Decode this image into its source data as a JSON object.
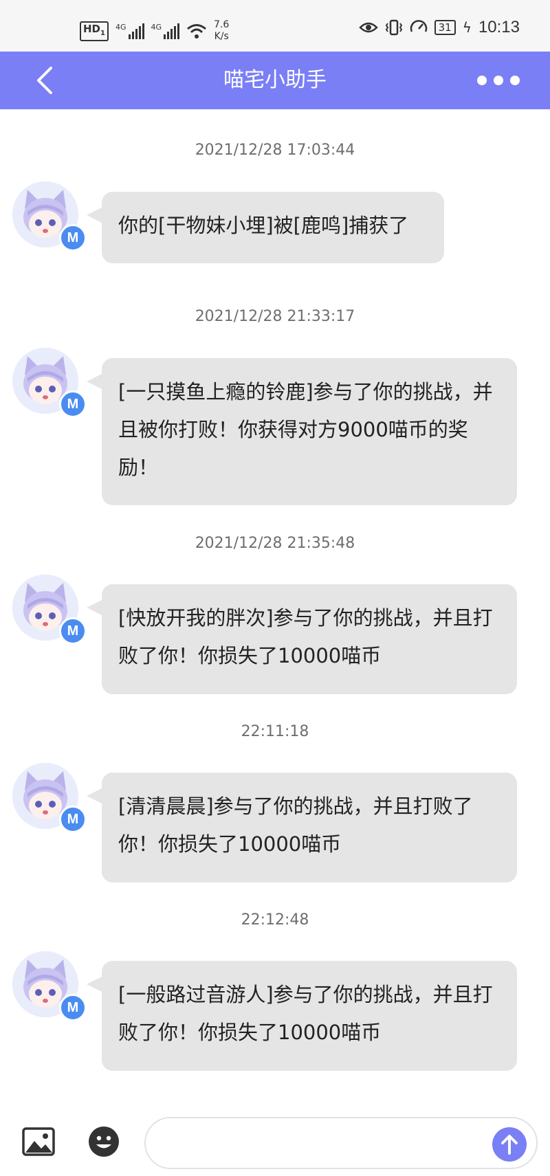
{
  "status_bar": {
    "hd": "HD",
    "sim": "1",
    "sig1_label": "4G",
    "sig2_label": "4G",
    "speed_value": "7.6",
    "speed_unit": "K/s",
    "battery": "31",
    "time": "10:13"
  },
  "header": {
    "title": "喵宅小助手"
  },
  "messages": [
    {
      "timestamp": "2021/12/28 17:03:44",
      "avatar_badge": "M",
      "text": "你的[干物妹小埋]被[鹿鸣]捕获了"
    },
    {
      "timestamp": "2021/12/28 21:33:17",
      "avatar_badge": "M",
      "text": "[一只摸鱼上瘾的铃鹿]参与了你的挑战，并且被你打败！你获得对方9000喵币的奖励！"
    },
    {
      "timestamp": "2021/12/28 21:35:48",
      "avatar_badge": "M",
      "text": "[快放开我的胖次]参与了你的挑战，并且打败了你！你损失了10000喵币"
    },
    {
      "timestamp": "22:11:18",
      "avatar_badge": "M",
      "text": "[清清晨晨]参与了你的挑战，并且打败了你！你损失了10000喵币"
    },
    {
      "timestamp": "22:12:48",
      "avatar_badge": "M",
      "text": "[一般路过音游人]参与了你的挑战，并且打败了你！你损失了10000喵币"
    }
  ],
  "input": {
    "value": "",
    "placeholder": ""
  },
  "colors": {
    "accent": "#7a7ff5",
    "bubble": "#e5e5e5",
    "badge": "#4a8cf0"
  },
  "icons": {
    "back": "chevron-left-icon",
    "more": "more-dots-icon",
    "image": "image-icon",
    "emoji": "emoji-icon",
    "send": "arrow-up-icon"
  }
}
